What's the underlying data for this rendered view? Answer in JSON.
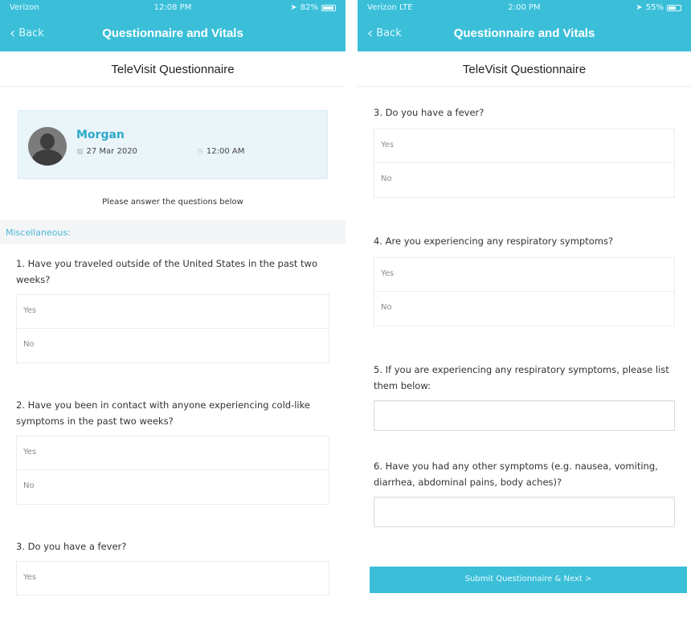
{
  "colors": {
    "primary": "#3bbfd9",
    "accent_text": "#2fa9c9",
    "card_bg": "#eaf5fa"
  },
  "left": {
    "status": {
      "carrier": "Verizon",
      "time": "12:08 PM",
      "battery": "82%",
      "battery_level": 0.82
    },
    "nav": {
      "back": "Back",
      "title": "Questionnaire and Vitals"
    },
    "page_title": "TeleVisit Questionnaire",
    "patient": {
      "name": "Morgan",
      "date": "27 Mar 2020",
      "time": "12:00 AM"
    },
    "instructions": "Please answer the questions below",
    "section": "Miscellaneous:",
    "q1": {
      "text": "1. Have you traveled outside of the United States in the past two weeks?",
      "options": [
        "Yes",
        "No"
      ]
    },
    "q2": {
      "text": "2. Have you been in contact with anyone experiencing cold-like symptoms in the past two weeks?",
      "options": [
        "Yes",
        "No"
      ]
    },
    "q3": {
      "text": "3. Do you have a fever?",
      "options": [
        "Yes"
      ]
    }
  },
  "right": {
    "status": {
      "carrier": "Verizon LTE",
      "time": "2:00 PM",
      "battery": "55%",
      "battery_level": 0.55
    },
    "nav": {
      "back": "Back",
      "title": "Questionnaire and Vitals"
    },
    "page_title": "TeleVisit Questionnaire",
    "q3": {
      "text": "3. Do you have a fever?",
      "options": [
        "Yes",
        "No"
      ]
    },
    "q4": {
      "text": "4. Are you experiencing any respiratory symptoms?",
      "options": [
        "Yes",
        "No"
      ]
    },
    "q5": {
      "text": "5. If you are experiencing any respiratory symptoms, please list them below:"
    },
    "q6": {
      "text": "6. Have you had any other symptoms (e.g. nausea, vomiting, diarrhea, abdominal pains, body aches)?"
    },
    "submit": "Submit Questionnaire & Next >"
  }
}
